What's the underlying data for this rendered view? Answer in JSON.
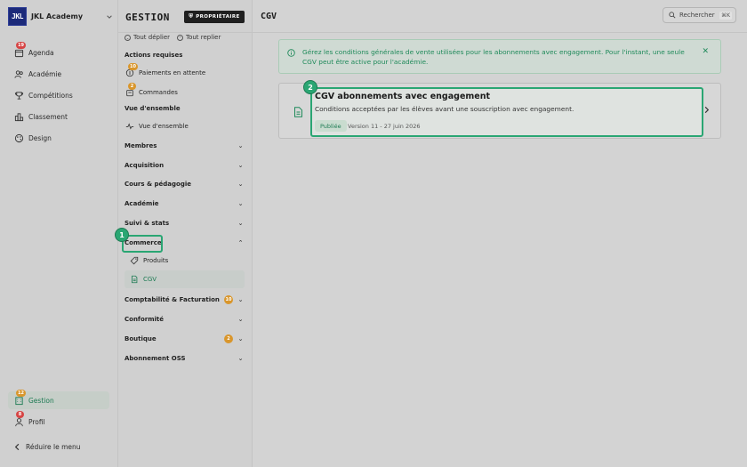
{
  "nav": {
    "brand_logo": "JKL",
    "brand_name": "JKL Academy",
    "items": [
      {
        "label": "Agenda",
        "badge": "19",
        "icon": "calendar-icon"
      },
      {
        "label": "Académie",
        "badge": "",
        "icon": "users-icon"
      },
      {
        "label": "Compétitions",
        "badge": "",
        "icon": "trophy-icon"
      },
      {
        "label": "Classement",
        "badge": "",
        "icon": "chart-bar-icon"
      },
      {
        "label": "Design",
        "badge": "",
        "icon": "palette-icon"
      }
    ],
    "bottom_items": [
      {
        "label": "Gestion",
        "badge": "12",
        "icon": "building-icon",
        "active": true
      },
      {
        "label": "Profil",
        "badge": "8",
        "icon": "user-icon"
      }
    ],
    "collapse_label": "Réduire le menu"
  },
  "sub": {
    "title": "GESTION",
    "owner_badge": "PROPRIÉTAIRE",
    "expand_all": "Tout déplier",
    "collapse_all": "Tout replier",
    "required_actions_label": "Actions requises",
    "required_actions": [
      {
        "label": "Paiements en attente",
        "badge": "10"
      },
      {
        "label": "Commandes",
        "badge": "2"
      }
    ],
    "overview_label": "Vue d'ensemble",
    "overview_item": "Vue d'ensemble",
    "groups": [
      {
        "label": "Membres",
        "badge": ""
      },
      {
        "label": "Acquisition",
        "badge": ""
      },
      {
        "label": "Cours & pédagogie",
        "badge": ""
      },
      {
        "label": "Académie",
        "badge": ""
      },
      {
        "label": "Suivi & stats",
        "badge": ""
      },
      {
        "label": "Commerce",
        "badge": "",
        "expanded": true
      },
      {
        "label": "Comptabilité & Facturation",
        "badge": "10"
      },
      {
        "label": "Conformité",
        "badge": ""
      },
      {
        "label": "Boutique",
        "badge": "2"
      },
      {
        "label": "Abonnement OSS",
        "badge": ""
      }
    ],
    "commerce_children": [
      {
        "label": "Produits",
        "icon": "tag-icon"
      },
      {
        "label": "CGV",
        "icon": "document-icon",
        "active": true
      }
    ]
  },
  "steps": {
    "one": "1",
    "two": "2"
  },
  "main": {
    "title": "CGV",
    "search_label": "Rechercher",
    "search_shortcut": "⌘K",
    "info_text": "Gérez les conditions générales de vente utilisées pour les abonnements avec engagement. Pour l'instant, une seule CGV peut être active pour l'académie.",
    "card": {
      "title": "CGV abonnements avec engagement",
      "description": "Conditions acceptées par les élèves avant une souscription avec engagement.",
      "status": "Publiée",
      "version": "Version 11 - 27 juin 2026"
    }
  },
  "colors": {
    "accent": "#2aa673",
    "accent_dark": "#1d7b53",
    "badge_red": "#d64545",
    "badge_orange": "#d9962c",
    "logo_bg": "#1c2a7a"
  }
}
